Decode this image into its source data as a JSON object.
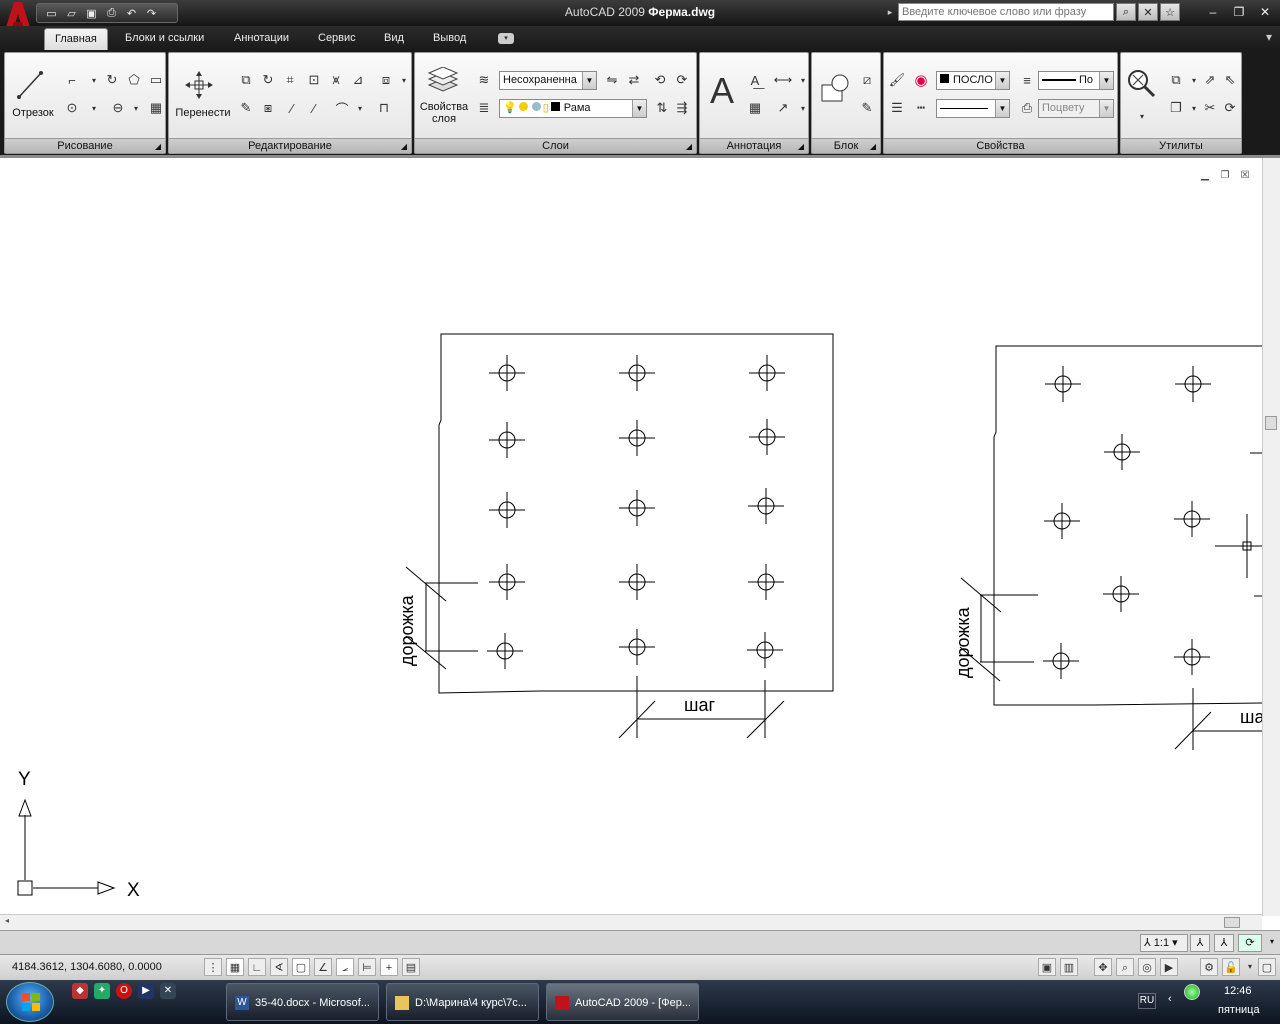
{
  "titlebar": {
    "app_name": "AutoCAD 2009",
    "file_name": "Ферма.dwg",
    "search_placeholder": "Введите ключевое слово или фразу"
  },
  "tabs": [
    {
      "label": "Главная",
      "active": true
    },
    {
      "label": "Блоки и ссылки",
      "active": false
    },
    {
      "label": "Аннотации",
      "active": false
    },
    {
      "label": "Сервис",
      "active": false
    },
    {
      "label": "Вид",
      "active": false
    },
    {
      "label": "Вывод",
      "active": false
    }
  ],
  "panels": {
    "draw": {
      "title": "Рисование",
      "line_label": "Отрезок"
    },
    "modify": {
      "title": "Редактирование",
      "move_label": "Перенести"
    },
    "layers": {
      "title": "Слои",
      "props_label": "Свойства слоя",
      "state_value": "Несохраненна",
      "layer_value": "Рама"
    },
    "annotation": {
      "title": "Аннотация"
    },
    "block": {
      "title": "Блок"
    },
    "properties": {
      "title": "Свойства",
      "color_value": "ПОСЛО",
      "lineweight_value": "По",
      "plotstyle_value": "Поцвету"
    },
    "utilities": {
      "title": "Утилиты"
    }
  },
  "drawing": {
    "left_frame": {
      "path_label": "дорожка",
      "step_label": "шаг"
    },
    "right_frame": {
      "path_label": "дорожка",
      "step_label": "ша"
    },
    "ucs": {
      "y_label": "Y",
      "x_label": "X"
    }
  },
  "annotation_bar": {
    "scale": "1:1"
  },
  "status": {
    "coordinates": "4184.3612, 1304.6080, 0.0000"
  },
  "taskbar": {
    "items": [
      {
        "label": "35-40.docx - Microsof..."
      },
      {
        "label": "D:\\Марина\\4 курс\\7с..."
      },
      {
        "label": "AutoCAD 2009 - [Фер..."
      }
    ],
    "lang": "RU",
    "time": "12:46",
    "day": "пятница"
  },
  "colors": {
    "accent_red": "#c0121b",
    "ribbon_bg": "#ececec",
    "drawing_bg": "#ffffff",
    "taskbar_bg": "#14202e"
  }
}
